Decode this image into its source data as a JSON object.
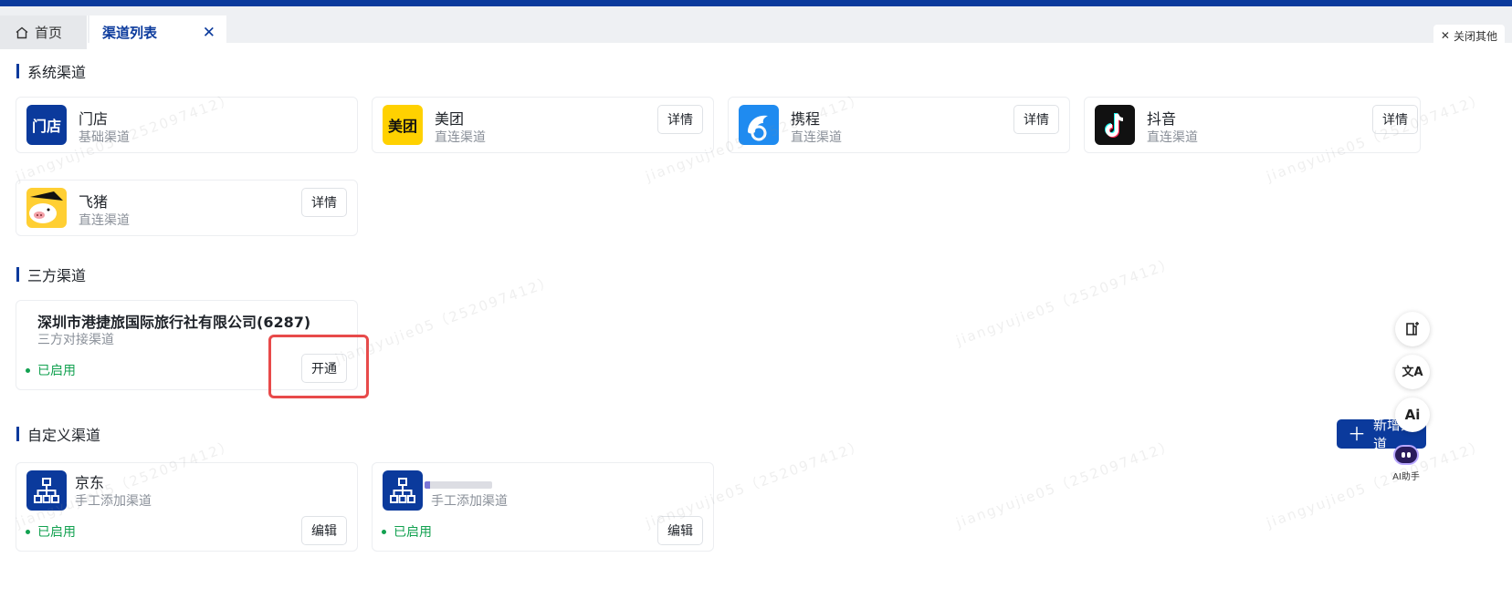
{
  "tabs": {
    "home_label": "首页",
    "active_label": "渠道列表",
    "close_others_label": "关闭其他"
  },
  "system_channels": {
    "title": "系统渠道",
    "items": [
      {
        "logo_text": "门店",
        "name": "门店",
        "type": "基础渠道",
        "action": ""
      },
      {
        "logo_text": "美团",
        "name": "美团",
        "type": "直连渠道",
        "action": "详情"
      },
      {
        "logo_text": "",
        "name": "携程",
        "type": "直连渠道",
        "action": "详情"
      },
      {
        "logo_text": "",
        "name": "抖音",
        "type": "直连渠道",
        "action": "详情"
      },
      {
        "logo_text": "",
        "name": "飞猪",
        "type": "直连渠道",
        "action": "详情"
      }
    ]
  },
  "third_party_channels": {
    "title": "三方渠道",
    "items": [
      {
        "name": "深圳市港捷旅国际旅行社有限公司(6287)",
        "type": "三方对接渠道",
        "status": "已启用",
        "action": "开通"
      }
    ]
  },
  "custom_channels": {
    "title": "自定义渠道",
    "add_label": "新增渠道",
    "items": [
      {
        "name": "京东",
        "type": "手工添加渠道",
        "status": "已启用",
        "action": "编辑"
      },
      {
        "name": "",
        "type": "手工添加渠道",
        "status": "已启用",
        "action": "编辑"
      }
    ]
  },
  "floating": {
    "translate_label": "文A",
    "ai_label": "Ai",
    "assistant_label": "AI助手"
  },
  "watermark": "jiangyujie05（2520974​12）",
  "colors": {
    "brand": "#0b3a9c",
    "enabled": "#12a150",
    "highlight": "#e84a4a"
  }
}
